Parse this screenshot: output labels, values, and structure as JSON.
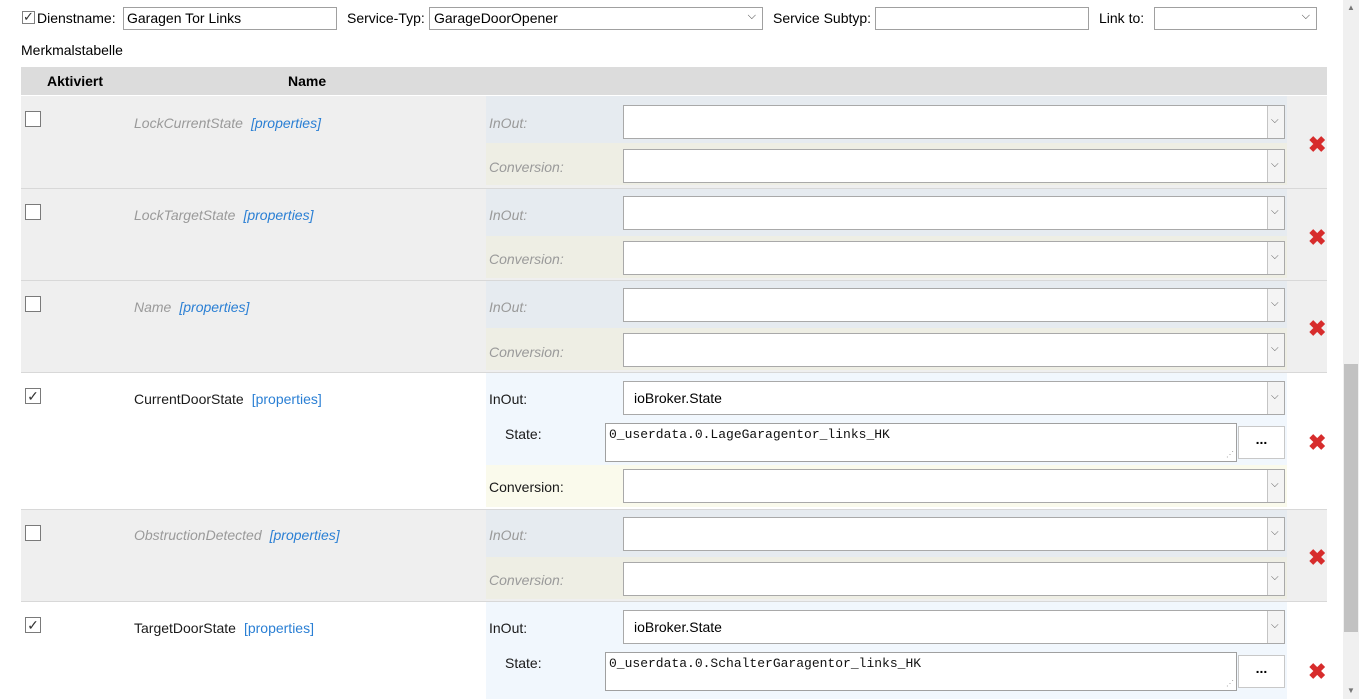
{
  "header": {
    "dienstname_label": "Dienstname:",
    "dienstname_value": "Garagen Tor Links",
    "servicetyp_label": "Service-Typ:",
    "servicetyp_value": "GarageDoorOpener",
    "subtyp_label": "Service Subtyp:",
    "subtyp_value": "",
    "linkto_label": "Link to:",
    "linkto_value": ""
  },
  "table_title": "Merkmalstabelle",
  "columns": {
    "aktiviert": "Aktiviert",
    "name": "Name"
  },
  "props_link": "[properties]",
  "labels": {
    "inout": "InOut:",
    "conversion": "Conversion:",
    "state": "State:",
    "dots": "..."
  },
  "rows": [
    {
      "name": "LockCurrentState",
      "enabled": false,
      "inout": "",
      "conversion": ""
    },
    {
      "name": "LockTargetState",
      "enabled": false,
      "inout": "",
      "conversion": ""
    },
    {
      "name": "Name",
      "enabled": false,
      "inout": "",
      "conversion": ""
    },
    {
      "name": "CurrentDoorState",
      "enabled": true,
      "inout": "ioBroker.State",
      "state": "0_userdata.0.LageGaragentor_links_HK",
      "conversion": ""
    },
    {
      "name": "ObstructionDetected",
      "enabled": false,
      "inout": "",
      "conversion": ""
    },
    {
      "name": "TargetDoorState",
      "enabled": true,
      "inout": "ioBroker.State",
      "state": "0_userdata.0.SchalterGaragentor_links_HK",
      "conversion": ""
    }
  ],
  "colors": {
    "delete": "#d72c2c",
    "link": "#2a7fd4",
    "header_bg": "#dcdcdc"
  }
}
